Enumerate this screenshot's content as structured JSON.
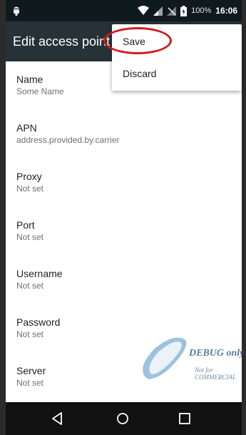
{
  "status_bar": {
    "battery_text": "100%",
    "time": "16:06",
    "icons": [
      "debug-android-icon",
      "wifi-icon",
      "signal-icon",
      "no-signal-icon",
      "battery-charging-icon"
    ]
  },
  "app_bar": {
    "title": "Edit access point"
  },
  "menu": {
    "save_label": "Save",
    "discard_label": "Discard",
    "highlight_color": "#d01b1b"
  },
  "list": {
    "items": [
      {
        "title": "Name",
        "value": "Some Name"
      },
      {
        "title": "APN",
        "value": "address.provided.by.carrier"
      },
      {
        "title": "Proxy",
        "value": "Not set"
      },
      {
        "title": "Port",
        "value": "Not set"
      },
      {
        "title": "Username",
        "value": "Not set"
      },
      {
        "title": "Password",
        "value": "Not set"
      },
      {
        "title": "Server",
        "value": "Not set"
      }
    ]
  },
  "watermark": {
    "line1": "DEBUG only",
    "line2": "Not for COMMERCIAL"
  },
  "nav_bar": {
    "icons": [
      "back-icon",
      "home-icon",
      "recents-icon"
    ]
  },
  "colors": {
    "status_bar": "#0f1a1f",
    "app_bar": "#263238",
    "nav_bar": "#111111"
  }
}
